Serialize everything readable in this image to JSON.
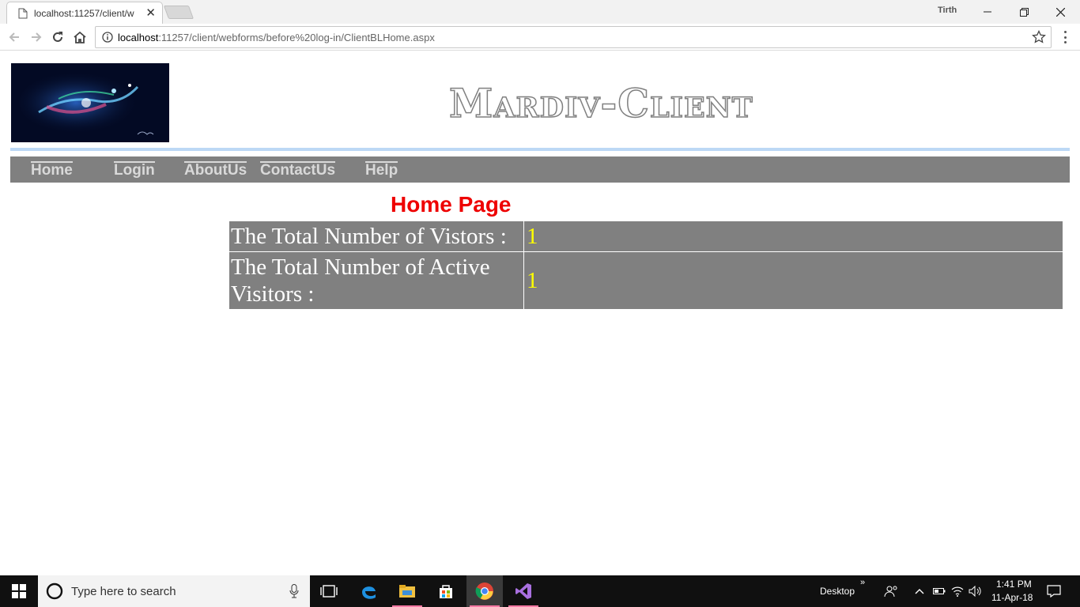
{
  "browser": {
    "tab_title": "localhost:11257/client/w",
    "profile_name": "Tirth",
    "url_host": "localhost",
    "url_path": ":11257/client/webforms/before%20log-in/ClientBLHome.aspx"
  },
  "site": {
    "title": "Mardiv-Client",
    "menu": [
      "Home",
      "Login",
      "AboutUs",
      "ContactUs",
      "Help"
    ],
    "heading": "Home Page",
    "stats": [
      {
        "label": "The Total Number of Vistors :",
        "value": "1"
      },
      {
        "label": "The Total Number of Active Visitors :",
        "value": "1"
      }
    ],
    "colors": {
      "heading": "#ee0000",
      "menu_bg": "#808080",
      "value_text": "#ffff00",
      "rule": "#bcd8f5"
    }
  },
  "taskbar": {
    "search_placeholder": "Type here to search",
    "desktop_label": "Desktop",
    "time": "1:41 PM",
    "date": "11-Apr-18",
    "pinned_icons": [
      "task-view-icon",
      "edge-icon",
      "file-explorer-icon",
      "store-icon",
      "chrome-icon",
      "visual-studio-icon"
    ]
  }
}
